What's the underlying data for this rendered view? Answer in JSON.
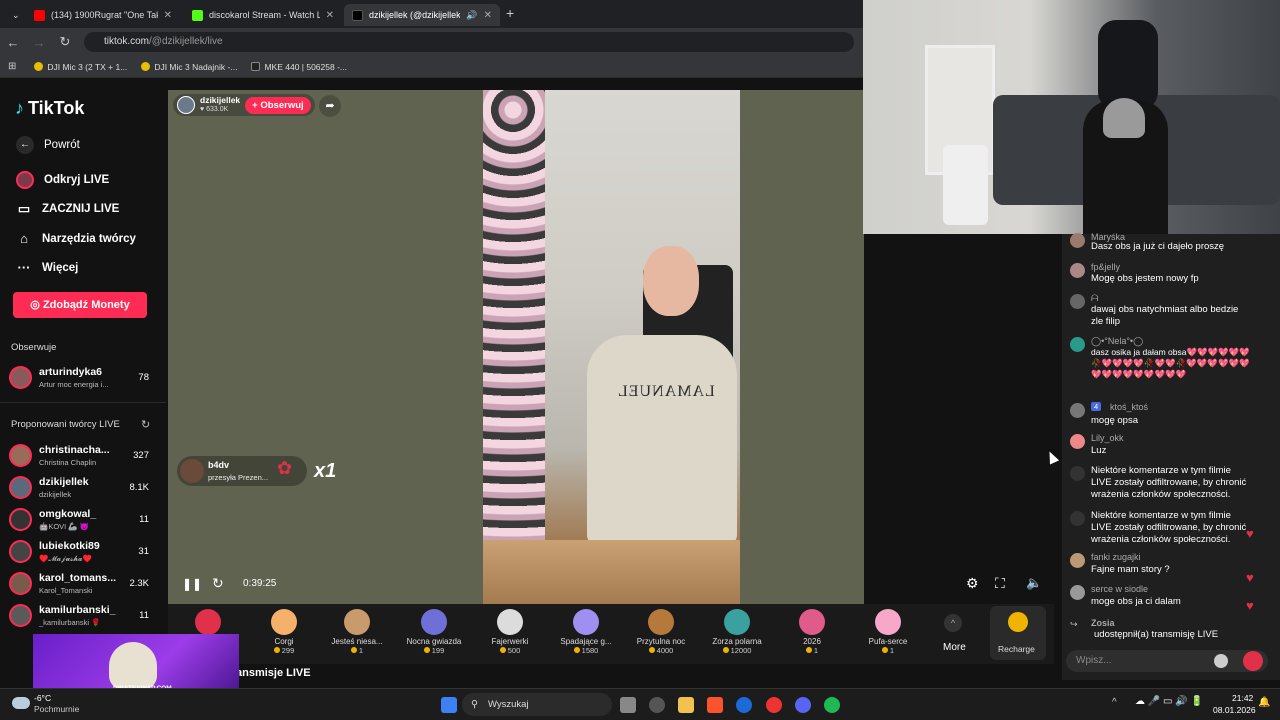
{
  "browser": {
    "tabs": [
      {
        "title": "(134) 1900Rugrat \"One Take Fre",
        "favicon": "youtube-icon",
        "color": "#ff0000"
      },
      {
        "title": "discokarol Stream - Watch Live",
        "favicon": "kick-icon",
        "color": "#53fc18"
      },
      {
        "title": "dzikijellek (@dzikijellek) pr",
        "favicon": "tiktok-icon",
        "color": "#000000"
      }
    ],
    "url_host": "tiktok.com",
    "url_path": "/@dzikijellek/live",
    "bookmarks": [
      "DJI Mic 3 (2 TX + 1...",
      "DJI Mic 3 Nadajnik -...",
      "MKE 440 | 506258 -..."
    ]
  },
  "sidebar": {
    "logo": "TikTok",
    "back": "Powrót",
    "nav": [
      "Odkryj LIVE",
      "ZACZNIJ LIVE",
      "Narzędzia twórcy",
      "Więcej"
    ],
    "coins_button": "Zdobądź Monety",
    "following_header": "Obserwuje",
    "following": [
      {
        "name": "arturindyka6",
        "sub": "Artur moc energia i...",
        "count": "78"
      }
    ],
    "suggested_header": "Proponowani twórcy LIVE",
    "suggested": [
      {
        "name": "christinacha...",
        "sub": "Christina Chaplin",
        "count": "327"
      },
      {
        "name": "dzikijellek",
        "sub": "dzikijellek",
        "count": "8.1K"
      },
      {
        "name": "omgkowal_",
        "sub": "🤖KOVI 🦾 😈",
        "count": "11"
      },
      {
        "name": "lubiekotki89",
        "sub": "♥️𝓜𝓪𝓳𝓾𝓼𝓱𝓪♥️",
        "count": "31"
      },
      {
        "name": "karol_tomans...",
        "sub": "Karol_Tomanski",
        "count": "2.3K"
      },
      {
        "name": "kamilurbanski_",
        "sub": "_kamilurbanski 🌹",
        "count": "11"
      }
    ]
  },
  "player": {
    "host": "dzikijellek",
    "likes": "633.0K",
    "follow_label": "+ Obserwuj",
    "gift_sender": "b4dv",
    "gift_text": "przesyła Prezen...",
    "gift_multiplier": "x1",
    "time": "0:39:25",
    "shirt_text": "LAMANUEL"
  },
  "gifts": [
    {
      "name": "Corgi",
      "price": "299",
      "color": "#f5b06a"
    },
    {
      "name": "Jesteś niesa...",
      "price": "1",
      "color": "#c99a6b"
    },
    {
      "name": "Nocna gwiazda",
      "price": "199",
      "color": "#6f6fd8"
    },
    {
      "name": "Fajerwerki",
      "price": "500",
      "color": "#dcdcdc"
    },
    {
      "name": "Spadające g...",
      "price": "1580",
      "color": "#9e8ff0"
    },
    {
      "name": "Przytulna noc",
      "price": "4000",
      "color": "#b57a3a"
    },
    {
      "name": "Zorza polarna",
      "price": "12000",
      "color": "#3aa0a0"
    },
    {
      "name": "2026",
      "price": "1",
      "color": "#e05a8a"
    },
    {
      "name": "Pufa-serce",
      "price": "1",
      "color": "#f7a8c8"
    }
  ],
  "gift_more": "More",
  "recharge": "Recharge",
  "chat": {
    "messages": [
      {
        "user": "Maryśka",
        "text": "Dasz obs ja już ci dajeło proszę"
      },
      {
        "user": "fp&jelly",
        "text": "Mogę obs jestem nowy fp"
      },
      {
        "user": "ᗩ",
        "text": "dawaj obs natychmiast albo bedzie zle filip"
      },
      {
        "user": "◯•°Nela°•◯",
        "text": "dasz osika ja dałam obsa💖💖💖💖💖💖🥀💖💖💖💖🥀💖💖🥀💖💖💖💖💖💖💖💖💖💖💖💖💖💖💖"
      },
      {
        "user": "ktoś_ktoś",
        "badge": "4",
        "text": "mogę opsa"
      },
      {
        "user": "Lily_okk",
        "text": "Luz"
      },
      {
        "user": "",
        "text": "Niektóre komentarze w tym filmie LIVE zostały odfiltrowane, by chronić wrażenia członków społeczności."
      },
      {
        "user": "",
        "text": "Niektóre komentarze w tym filmie LIVE zostały odfiltrowane, by chronić wrażenia członków społeczności."
      },
      {
        "user": "fanki zugajki",
        "text": "Fajne mam story ?"
      },
      {
        "user": "serce w siodle",
        "text": "moge obs ja ci dalam"
      },
      {
        "user": "Zosia",
        "text": "udostępnił(a) transmisję LIVE"
      }
    ],
    "placeholder": "Wpisz..."
  },
  "below_text": "ansmisje LIVE",
  "overlay_text": "PIRATESWAP.COM",
  "taskbar": {
    "weather_temp": "-6°C",
    "weather_desc": "Pochmurnie",
    "search": "Wyszukaj",
    "time": "21:42",
    "date": "08.01.2026"
  }
}
